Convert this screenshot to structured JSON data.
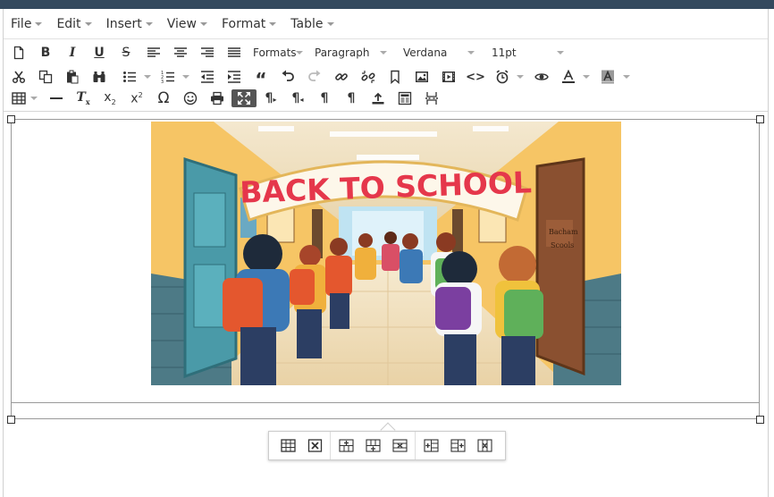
{
  "menubar": {
    "items": [
      {
        "label": "File"
      },
      {
        "label": "Edit"
      },
      {
        "label": "Insert"
      },
      {
        "label": "View"
      },
      {
        "label": "Format"
      },
      {
        "label": "Table"
      }
    ]
  },
  "toolbar": {
    "formats_label": "Formats",
    "block_format": "Paragraph",
    "font_family": "Verdana",
    "font_size": "11pt",
    "icons": [
      "new-document-icon",
      "bold-icon",
      "italic-icon",
      "underline-icon",
      "strikethrough-icon",
      "align-left-icon",
      "align-center-icon",
      "align-right-icon",
      "align-justify-icon",
      "cut-icon",
      "copy-icon",
      "paste-icon",
      "find-replace-icon",
      "bullet-list-icon",
      "numbered-list-icon",
      "outdent-icon",
      "indent-icon",
      "blockquote-icon",
      "undo-icon",
      "redo-icon",
      "link-icon",
      "unlink-icon",
      "anchor-icon",
      "image-icon",
      "media-icon",
      "code-icon",
      "clock-icon",
      "preview-icon",
      "text-color-icon",
      "background-color-icon",
      "table-icon",
      "horizontal-rule-icon",
      "clear-formatting-icon",
      "subscript-icon",
      "superscript-icon",
      "omega-icon",
      "emoticon-icon",
      "print-icon",
      "fullscreen-icon",
      "ltr-icon",
      "rtl-icon",
      "show-blocks-icon",
      "visual-chars-icon",
      "upload-icon",
      "template-icon",
      "page-break-icon"
    ]
  },
  "content": {
    "image": {
      "banner_text": "BACK TO SCHOOL",
      "door_sign": "Bacham Scools"
    }
  },
  "table_toolbar": {
    "icons": [
      "table-properties-icon",
      "delete-table-icon",
      "insert-row-before-icon",
      "insert-row-after-icon",
      "delete-row-icon",
      "insert-column-before-icon",
      "insert-column-after-icon",
      "delete-column-icon"
    ]
  },
  "colors": {
    "topbar": "#34495e",
    "active_button": "#555555",
    "wall": "#f6c565",
    "door_teal": "#4a9aa8",
    "door_brown": "#8a5030",
    "floor": "#f1e2c4"
  }
}
